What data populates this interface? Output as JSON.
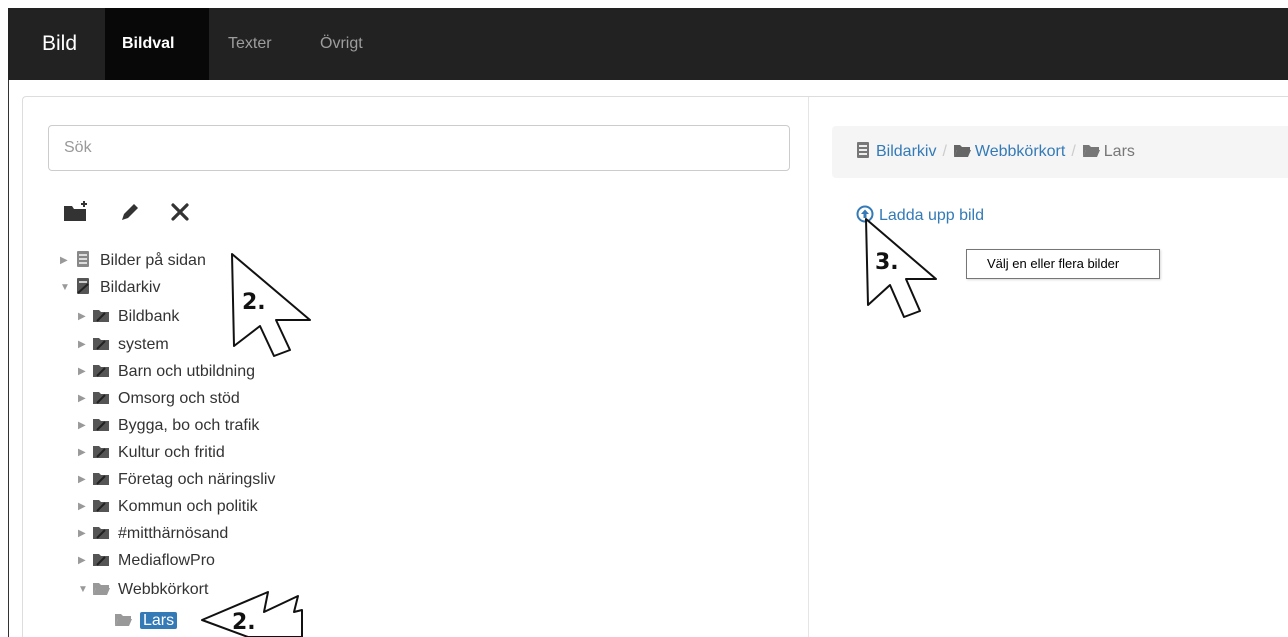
{
  "nav": {
    "brand": "Bild",
    "tabs": [
      {
        "label": "Bildval",
        "active": true
      },
      {
        "label": "Texter",
        "active": false
      },
      {
        "label": "Övrigt",
        "active": false
      }
    ]
  },
  "search": {
    "placeholder": "Sök"
  },
  "toolbar": {
    "icons": [
      "new-folder-icon",
      "pencil-icon",
      "close-icon"
    ]
  },
  "tree": {
    "items": [
      {
        "label": "Bilder på sidan",
        "icon": "archive-icon",
        "expanded": false
      },
      {
        "label": "Bildarkiv",
        "icon": "archive-icon",
        "expanded": true
      },
      {
        "label": "Bildbank",
        "icon": "folder-icon",
        "expanded": false
      },
      {
        "label": "system",
        "icon": "folder-icon",
        "expanded": false
      },
      {
        "label": "Barn och utbildning",
        "icon": "folder-icon",
        "expanded": false
      },
      {
        "label": "Omsorg och stöd",
        "icon": "folder-icon",
        "expanded": false
      },
      {
        "label": "Bygga, bo och trafik",
        "icon": "folder-icon",
        "expanded": false
      },
      {
        "label": "Kultur och fritid",
        "icon": "folder-icon",
        "expanded": false
      },
      {
        "label": "Företag och näringsliv",
        "icon": "folder-icon",
        "expanded": false
      },
      {
        "label": "Kommun och politik",
        "icon": "folder-icon",
        "expanded": false
      },
      {
        "label": "#mitthärnösand",
        "icon": "folder-icon",
        "expanded": false
      },
      {
        "label": "MediaflowPro",
        "icon": "folder-icon",
        "expanded": false
      },
      {
        "label": "Webbkörkort",
        "icon": "folder-open-icon",
        "expanded": true
      },
      {
        "label": "Lars",
        "icon": "folder-open-icon",
        "selected": true
      }
    ]
  },
  "breadcrumb": {
    "items": [
      "Bildarkiv",
      "Webbkörkort",
      "Lars"
    ],
    "separator": "/"
  },
  "upload": {
    "label": "Ladda upp bild"
  },
  "tooltip": {
    "text": "Välj en eller flera bilder"
  },
  "annotations": {
    "step_2": "2.",
    "step_3": "3."
  },
  "colors": {
    "navbar": "#222222",
    "link": "#337ab7",
    "selected": "#337ab7"
  }
}
